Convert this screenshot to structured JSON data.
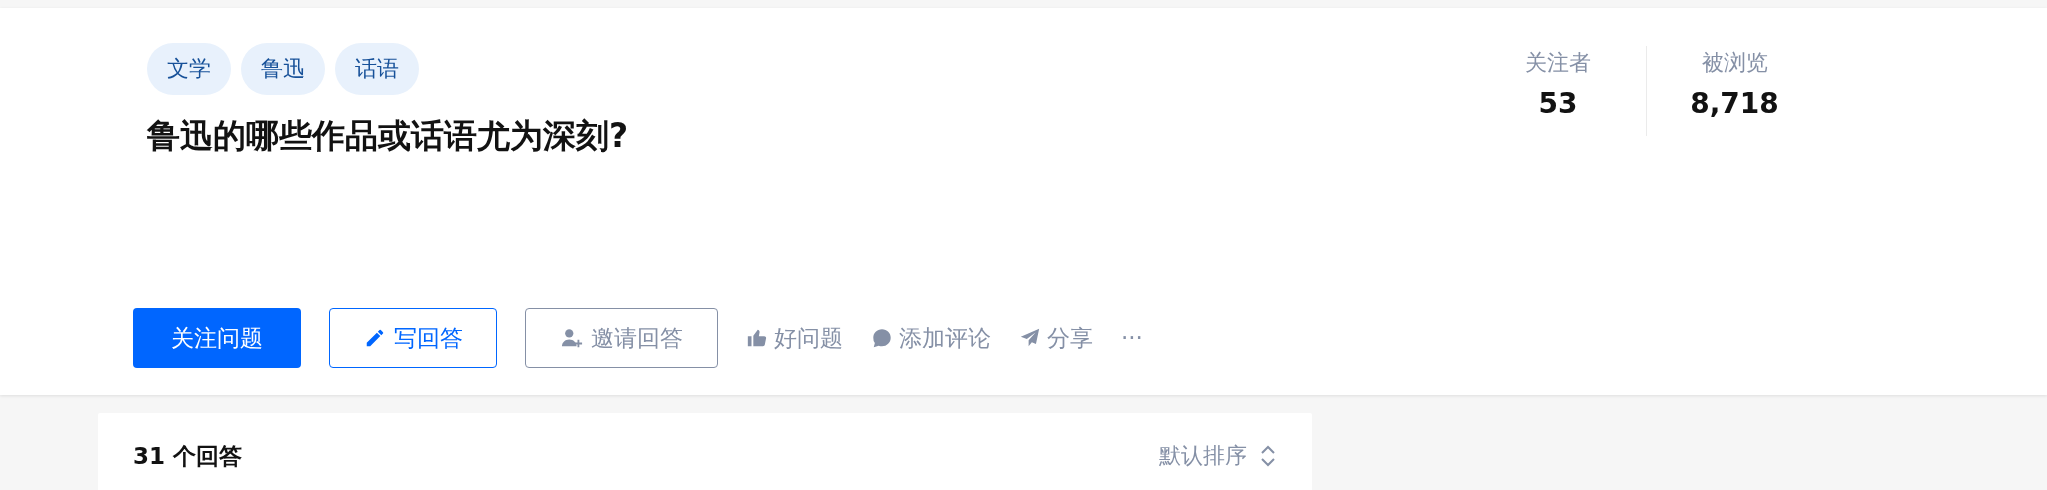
{
  "tags": [
    "文学",
    "鲁迅",
    "话语"
  ],
  "title": "鲁迅的哪些作品或话语尤为深刻?",
  "stats": [
    {
      "label": "关注者",
      "value": "53"
    },
    {
      "label": "被浏览",
      "value": "8,718"
    }
  ],
  "actions": [
    {
      "kind": "primary",
      "label": "关注问题"
    },
    {
      "kind": "outline",
      "label": "写回答"
    },
    {
      "kind": "gray",
      "label": "邀请回答"
    },
    {
      "kind": "plain",
      "label": "好问题"
    },
    {
      "kind": "plain",
      "label": "添加评论"
    },
    {
      "kind": "plain",
      "label": "分享"
    },
    {
      "kind": "plain",
      "label": "···"
    }
  ],
  "answers": {
    "count": "31 个回答",
    "sort": "默认排序"
  }
}
